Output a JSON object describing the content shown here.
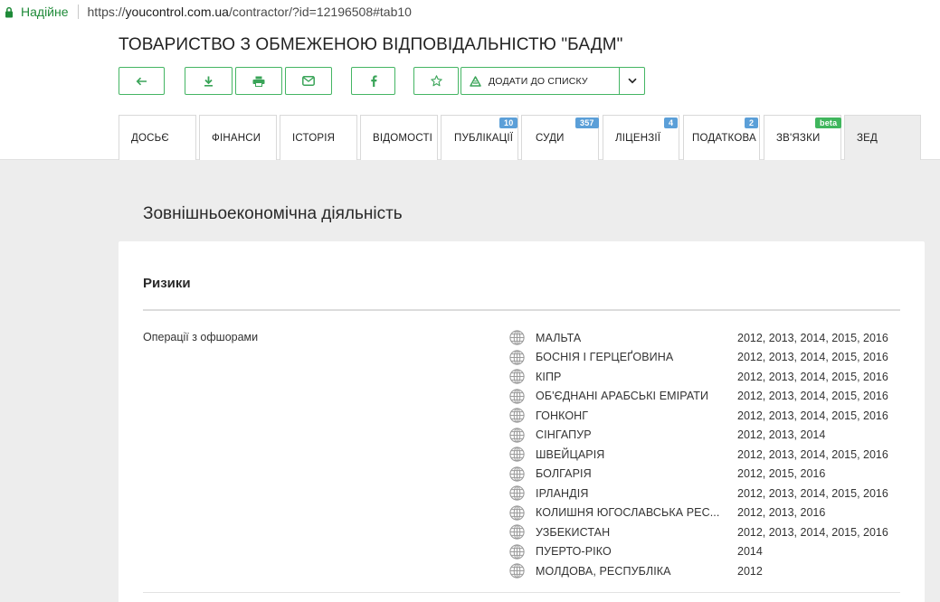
{
  "browser": {
    "secure_label": "Надійне",
    "url_scheme": "https://",
    "url_host": "youcontrol.com.ua",
    "url_path": "/contractor/?id=12196508#tab10"
  },
  "company": {
    "name": "ТОВАРИСТВО З ОБМЕЖЕНОЮ ВІДПОВІДАЛЬНІСТЮ \"БАДМ\""
  },
  "toolbar": {
    "add_to_list_label": "ДОДАТИ ДО СПИСКУ"
  },
  "tabs": [
    {
      "label": "ДОСЬЄ"
    },
    {
      "label": "ФІНАНСИ"
    },
    {
      "label": "ІСТОРІЯ"
    },
    {
      "label": "ВІДОМОСТІ"
    },
    {
      "label": "ПУБЛІКАЦІЇ",
      "badge": "10"
    },
    {
      "label": "СУДИ",
      "badge": "357"
    },
    {
      "label": "ЛІЦЕНЗІЇ",
      "badge": "4"
    },
    {
      "label": "ПОДАТКОВА",
      "badge": "2"
    },
    {
      "label": "ЗВ'ЯЗКИ",
      "badge": "beta"
    },
    {
      "label": "ЗЕД"
    }
  ],
  "colors": {
    "accent_green": "#44b563",
    "badge_blue": "#5b9fd8",
    "badge_green": "#40b65d",
    "secure_green": "#1e8a38"
  },
  "main": {
    "section_title": "Зовнішньоекономічна діяльність",
    "card_title": "Ризики",
    "row_label": "Операції з офшорами",
    "countries": [
      {
        "name": "МАЛЬТА",
        "years": "2012, 2013, 2014, 2015, 2016"
      },
      {
        "name": "БОСНІЯ І ГЕРЦЕҐОВИНА",
        "years": "2012, 2013, 2014, 2015, 2016"
      },
      {
        "name": "КІПР",
        "years": "2012, 2013, 2014, 2015, 2016"
      },
      {
        "name": "ОБ'ЄДНАНІ АРАБСЬКІ ЕМІРАТИ",
        "years": "2012, 2013, 2014, 2015, 2016"
      },
      {
        "name": "ГОНКОНГ",
        "years": "2012, 2013, 2014, 2015, 2016"
      },
      {
        "name": "СІНГАПУР",
        "years": "2012, 2013, 2014"
      },
      {
        "name": "ШВЕЙЦАРІЯ",
        "years": "2012, 2013, 2014, 2015, 2016"
      },
      {
        "name": "БОЛГАРІЯ",
        "years": "2012, 2015, 2016"
      },
      {
        "name": "ІРЛАНДІЯ",
        "years": "2012, 2013, 2014, 2015, 2016"
      },
      {
        "name": "КОЛИШНЯ ЮГОСЛАВСЬКА РЕС...",
        "years": "2012, 2013, 2016"
      },
      {
        "name": "УЗБЕКИСТАН",
        "years": "2012, 2013, 2014, 2015, 2016"
      },
      {
        "name": "ПУЕРТО-РІКО",
        "years": "2014"
      },
      {
        "name": "МОЛДОВА, РЕСПУБЛІКА",
        "years": "2012"
      }
    ]
  }
}
